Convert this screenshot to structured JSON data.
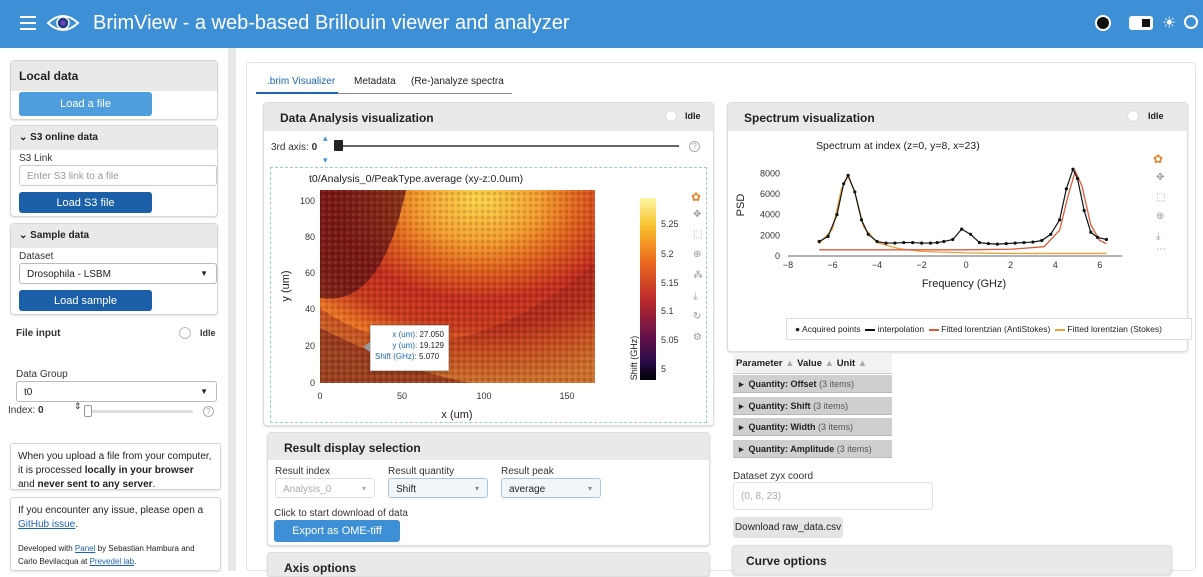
{
  "header": {
    "title": "BrimView - a web-based Brillouin viewer and analyzer"
  },
  "sidebar": {
    "local_data": {
      "title": "Local data",
      "load_button": "Load a file"
    },
    "s3": {
      "title": "S3 online data",
      "link_label": "S3 Link",
      "placeholder": "Enter S3 link to a file",
      "load_button": "Load S3 file"
    },
    "sample": {
      "title": "Sample data",
      "dataset_label": "Dataset",
      "dataset_value": "Drosophila - LSBM",
      "load_button": "Load sample"
    },
    "file_input": {
      "label": "File input",
      "status": "Idle"
    },
    "data_group": {
      "label": "Data Group",
      "value": "t0",
      "index_label": "Index:",
      "index_value": "0"
    },
    "notice1": {
      "text1": "When you upload a file from your computer, it is processed ",
      "bold1": "locally in your browser",
      "text2": " and ",
      "bold2": "never sent to any server",
      "text3": "."
    },
    "notice2": {
      "text1": "If you encounter any issue, please open a ",
      "link1": "GitHub issue",
      "text2": ".",
      "text3": "Developed with ",
      "link2": "Panel",
      "text4": " by Sebastian Hambura and Carlo Bevilacqua at ",
      "link3": "Prevedel lab",
      "text5": "."
    }
  },
  "tabs": [
    ".brim Visualizer",
    "Metadata",
    "(Re-)analyze spectra"
  ],
  "analysis": {
    "title": "Data Analysis visualization",
    "status": "Idle",
    "third_axis_label": "3rd axis:",
    "third_axis_value": "0",
    "plot_title": "t0/Analysis_0/PeakType.average (xy-z:0.0um)",
    "xlabel": "x (um)",
    "ylabel": "y (um)",
    "colorbar_label": "Shift (GHz)",
    "x_ticks": [
      "0",
      "50",
      "100",
      "150"
    ],
    "y_ticks": [
      "0",
      "20",
      "40",
      "60",
      "80",
      "100"
    ],
    "cb_ticks": [
      "5.25",
      "5.2",
      "5.15",
      "5.1",
      "5.05",
      "5"
    ],
    "tooltip": {
      "x_label": "x (um):",
      "x_val": "27.050",
      "y_label": "y (um):",
      "y_val": "19.129",
      "s_label": "Shift (GHz):",
      "s_val": "5.070"
    }
  },
  "result_display": {
    "title": "Result display selection",
    "index_label": "Result index",
    "index_value": "Analysis_0",
    "quantity_label": "Result quantity",
    "quantity_value": "Shift",
    "peak_label": "Result peak",
    "peak_value": "average",
    "download_label": "Click to start download of data",
    "export_button": "Export as OME-tiff"
  },
  "axis_options": {
    "title": "Axis options"
  },
  "spectrum": {
    "title": "Spectrum visualization",
    "status": "Idle",
    "plot_title": "Spectrum at index (z=0, y=8, x=23)",
    "xlabel": "Frequency (GHz)",
    "ylabel": "PSD",
    "x_ticks": [
      "−8",
      "−6",
      "−4",
      "−2",
      "0",
      "2",
      "4",
      "6"
    ],
    "y_ticks": [
      "0",
      "2000",
      "4000",
      "6000",
      "8000"
    ],
    "legend": [
      "Acquired points",
      "interpolation",
      "Fitted lorentzian (AntiStokes)",
      "Fitted lorentzian (Stokes)"
    ]
  },
  "parameters": {
    "headers": [
      "Parameter",
      "Value",
      "Unit"
    ],
    "rows": [
      {
        "name": "Quantity: Offset",
        "count": "(3 items)"
      },
      {
        "name": "Quantity: Shift",
        "count": "(3 items)"
      },
      {
        "name": "Quantity: Width",
        "count": "(3 items)"
      },
      {
        "name": "Quantity: Amplitude",
        "count": "(3 items)"
      }
    ]
  },
  "coords": {
    "label": "Dataset zyx coord",
    "value": "(0, 8, 23)",
    "download_button": "Download raw_data.csv"
  },
  "curve_options": {
    "title": "Curve options"
  },
  "colors": {
    "header": "#3d8fd6",
    "button_dark": "#1a5fa8",
    "button_light": "#4e9ddc",
    "tab_active": "#1b64b5",
    "stokes": "#e6a23c",
    "antistokes": "#e05a3a"
  },
  "chart_data": [
    {
      "type": "heatmap",
      "title": "t0/Analysis_0/PeakType.average (xy-z:0.0um)",
      "xlabel": "x (um)",
      "ylabel": "y (um)",
      "xlim": [
        0,
        180
      ],
      "ylim": [
        0,
        110
      ],
      "colorbar": {
        "label": "Shift (GHz)",
        "range": [
          4.98,
          5.28
        ],
        "colormap": "inferno"
      }
    },
    {
      "type": "line",
      "title": "Spectrum at index (z=0, y=8, x=23)",
      "xlabel": "Frequency (GHz)",
      "ylabel": "PSD",
      "xlim": [
        -8,
        7
      ],
      "ylim": [
        0,
        9000
      ],
      "series": [
        {
          "name": "Acquired points",
          "x": [
            -6.6,
            -6.2,
            -5.8,
            -5.5,
            -5.3,
            -5.0,
            -4.7,
            -4.4,
            -4.0,
            -3.6,
            -3.2,
            -2.8,
            -2.4,
            -2.0,
            -1.6,
            -1.3,
            -1.0,
            -0.6,
            -0.2,
            0.2,
            0.6,
            1.0,
            1.4,
            1.8,
            2.2,
            2.6,
            3.0,
            3.4,
            3.8,
            4.2,
            4.5,
            4.8,
            5.0,
            5.3,
            5.6,
            5.9,
            6.3
          ],
          "y": [
            1400,
            1900,
            4000,
            7000,
            7800,
            6200,
            3500,
            2100,
            1400,
            1250,
            1250,
            1300,
            1300,
            1250,
            1250,
            1300,
            1400,
            1600,
            2600,
            2100,
            1300,
            1200,
            1150,
            1200,
            1250,
            1300,
            1350,
            1500,
            2100,
            3500,
            6500,
            8400,
            7500,
            4400,
            2300,
            1800,
            1600
          ]
        },
        {
          "name": "interpolation",
          "x": [
            -6.6,
            -6.2,
            -5.8,
            -5.5,
            -5.3,
            -5.0,
            -4.7,
            -4.4,
            -4.0,
            -3.6,
            -3.2,
            -2.8,
            -2.4,
            -2.0,
            -1.6,
            -1.3,
            -1.0,
            -0.6,
            -0.2,
            0.2,
            0.6,
            1.0,
            1.4,
            1.8,
            2.2,
            2.6,
            3.0,
            3.4,
            3.8,
            4.2,
            4.5,
            4.8,
            5.0,
            5.3,
            5.6,
            5.9,
            6.3
          ],
          "y": [
            1400,
            1900,
            4000,
            7000,
            7800,
            6200,
            3500,
            2100,
            1400,
            1250,
            1250,
            1300,
            1300,
            1250,
            1250,
            1300,
            1400,
            1600,
            2600,
            2100,
            1300,
            1200,
            1150,
            1200,
            1250,
            1300,
            1350,
            1500,
            2100,
            3500,
            6500,
            8400,
            7500,
            4400,
            2300,
            1800,
            1600
          ]
        },
        {
          "name": "Fitted lorentzian (AntiStokes)",
          "x": [
            -6.6,
            -4,
            -2,
            0,
            2,
            3.5,
            4.2,
            4.6,
            4.9,
            5.2,
            5.6,
            6.0,
            6.3
          ],
          "y": [
            600,
            600,
            600,
            600,
            650,
            900,
            2500,
            6000,
            8200,
            6800,
            3000,
            1500,
            1200
          ]
        },
        {
          "name": "Fitted lorentzian (Stokes)",
          "x": [
            -6.6,
            -6.0,
            -5.6,
            -5.3,
            -5.0,
            -4.6,
            -4.0,
            -3.0,
            -2.0,
            0,
            2,
            4,
            6.3
          ],
          "y": [
            1200,
            2600,
            6500,
            7700,
            6200,
            2800,
            1300,
            700,
            450,
            300,
            250,
            250,
            250
          ]
        }
      ]
    }
  ]
}
